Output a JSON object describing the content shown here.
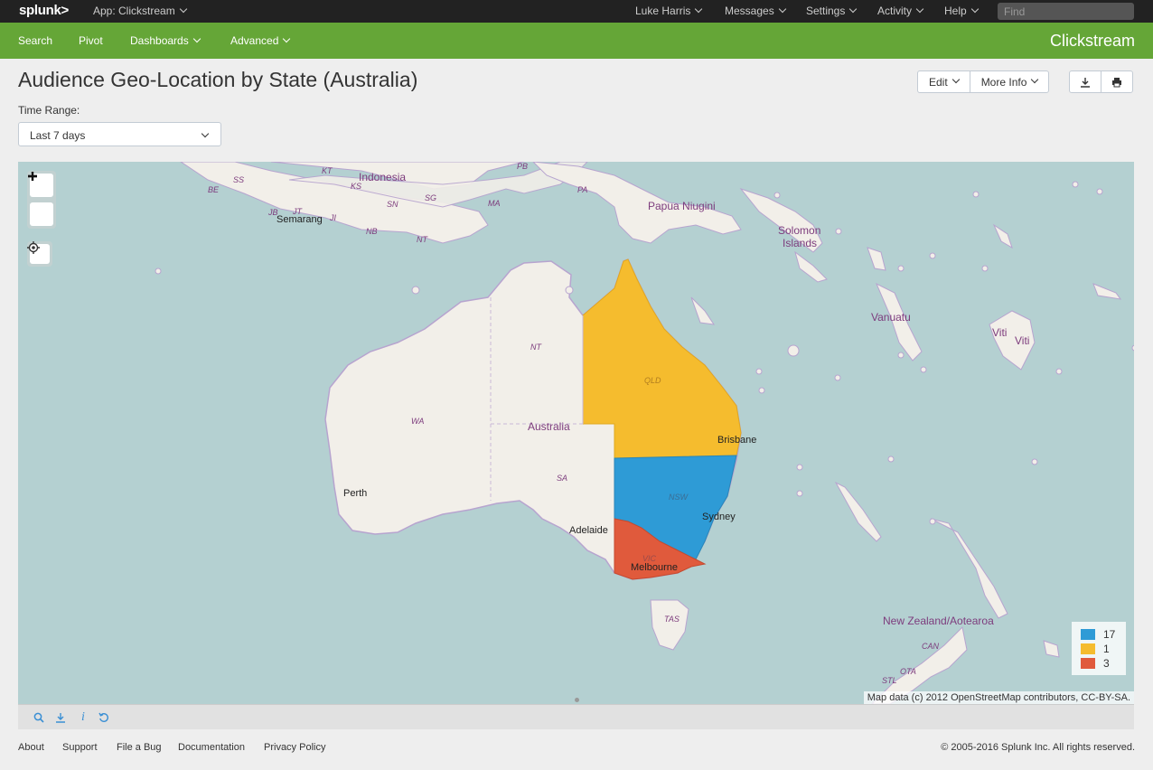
{
  "topbar": {
    "logo": "splunk>",
    "app_menu": "App: Clickstream",
    "user": "Luke Harris",
    "messages": "Messages",
    "settings": "Settings",
    "activity": "Activity",
    "help": "Help",
    "find_placeholder": "Find"
  },
  "nav": {
    "items": [
      "Search",
      "Pivot",
      "Dashboards",
      "Advanced"
    ],
    "app_title": "Clickstream"
  },
  "dashboard": {
    "title": "Audience Geo-Location by State (Australia)",
    "edit_label": "Edit",
    "more_info_label": "More Info",
    "time_range_label": "Time Range:",
    "time_range_value": "Last 7 days"
  },
  "map": {
    "legend": [
      {
        "value": "17",
        "color": "#2e9bd6"
      },
      {
        "value": "1",
        "color": "#f5bc2e"
      },
      {
        "value": "3",
        "color": "#e05a3c"
      }
    ],
    "attribution": "Map data (c) 2012 OpenStreetMap contributors, CC-BY-SA.",
    "labels": {
      "indonesia": "Indonesia",
      "semarang": "Semarang",
      "papua": "Papua Niugini",
      "solomon1": "Solomon",
      "solomon2": "Islands",
      "vanuatu": "Vanuatu",
      "viti1": "Viti",
      "viti2": "Viti",
      "australia": "Australia",
      "perth": "Perth",
      "adelaide": "Adelaide",
      "brisbane": "Brisbane",
      "sydney": "Sydney",
      "melbourne": "Melbourne",
      "nz": "New Zealand/Aotearoa",
      "nt": "NT",
      "wa": "WA",
      "sa": "SA",
      "qld": "QLD",
      "nsw": "NSW",
      "vic": "VIC",
      "tas": "TAS",
      "can": "CAN",
      "ota": "OTA",
      "stl": "STL",
      "kt": "KT",
      "pb": "PB",
      "ss": "SS",
      "be": "BE",
      "ks": "KS",
      "sn": "SN",
      "sg": "SG",
      "ma": "MA",
      "pa": "PA",
      "jb": "JB",
      "jt": "JT",
      "ji": "JI",
      "nb": "NB",
      "ntt": "NT"
    }
  },
  "footer": {
    "links": [
      "About",
      "Support",
      "File a Bug",
      "Documentation",
      "Privacy Policy"
    ],
    "copyright": "© 2005-2016 Splunk Inc. All rights reserved."
  }
}
